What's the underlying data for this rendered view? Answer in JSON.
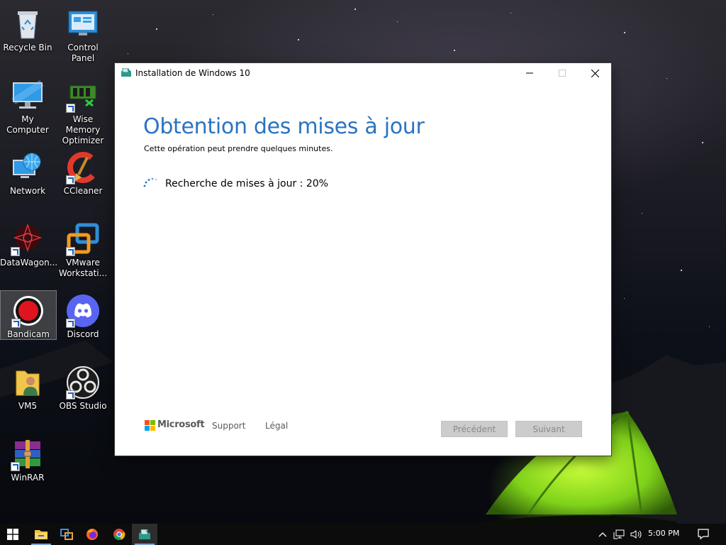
{
  "desktop": {
    "icons": [
      {
        "label": "Recycle Bin"
      },
      {
        "label": "Control Panel"
      },
      {
        "label": "My Computer"
      },
      {
        "label": "Wise Memory Optimizer"
      },
      {
        "label": "Network"
      },
      {
        "label": "CCleaner"
      },
      {
        "label": "DataWagon..."
      },
      {
        "label": "VMware Workstati..."
      },
      {
        "label": "Bandicam"
      },
      {
        "label": "Discord"
      },
      {
        "label": "VM5"
      },
      {
        "label": "OBS Studio"
      },
      {
        "label": "WinRAR"
      }
    ]
  },
  "window": {
    "title": "Installation de Windows 10",
    "heading": "Obtention des mises à jour",
    "subtitle": "Cette opération peut prendre quelques minutes.",
    "status": "Recherche de mises à jour : 20%",
    "progress_percent": 20,
    "footer": {
      "brand": "Microsoft",
      "support_link": "Support",
      "legal_link": "Légal",
      "back_button": "Précédent",
      "next_button": "Suivant"
    }
  },
  "taskbar": {
    "clock": "5:00 PM",
    "pinned": [
      "start-icon",
      "file-explorer-icon",
      "taskview-icon",
      "firefox-icon",
      "chrome-icon",
      "windows-setup-icon"
    ]
  },
  "colors": {
    "heading_blue": "#2a74c1",
    "taskbar": "#0c0c0c",
    "disabled_button": "#cccccc"
  }
}
